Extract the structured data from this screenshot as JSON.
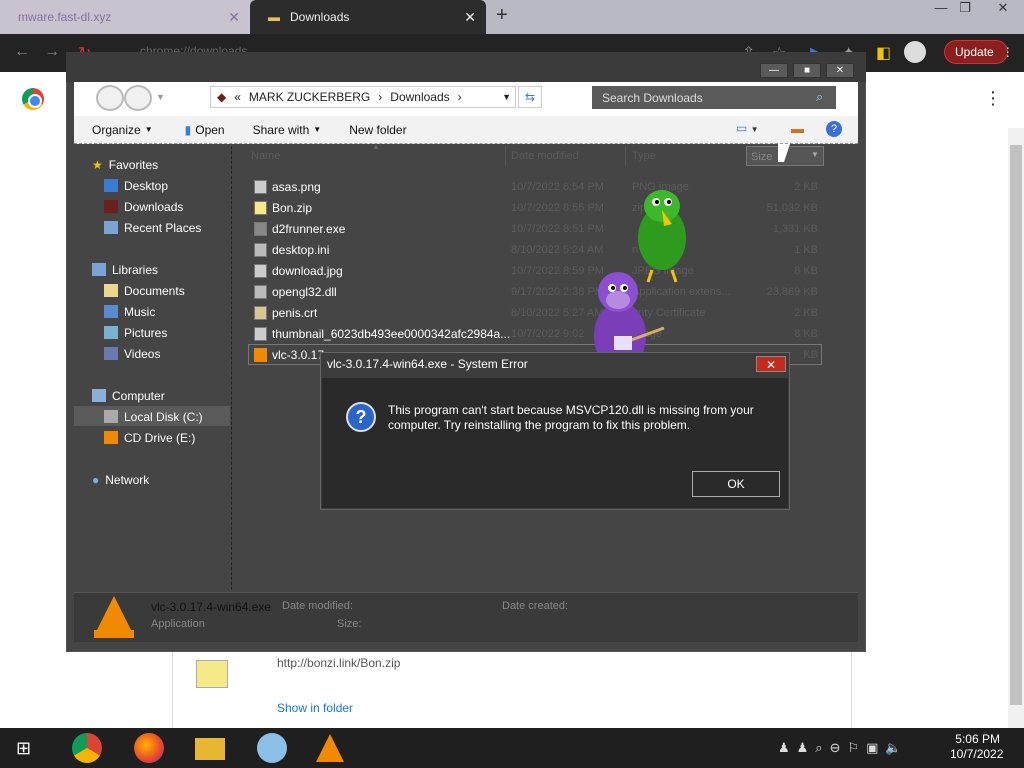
{
  "browser": {
    "tabs": [
      {
        "label": "mware.fast-dl.xyz"
      },
      {
        "label": "Downloads"
      }
    ],
    "address": "chrome://downloads",
    "update_label": "Update"
  },
  "explorer": {
    "breadcrumb": [
      "MARK ZUCKERBERG",
      "Downloads"
    ],
    "search_placeholder": "Search Downloads",
    "commands": [
      "Organize",
      "Open",
      "Share with",
      "New folder"
    ],
    "columns": [
      "Name",
      "Date modified",
      "Type",
      "Size"
    ],
    "nav": {
      "favorites": "Favorites",
      "favorites_items": [
        "Desktop",
        "Downloads",
        "Recent Places"
      ],
      "libraries": "Libraries",
      "libraries_items": [
        "Documents",
        "Music",
        "Pictures",
        "Videos"
      ],
      "computer": "Computer",
      "computer_items": [
        "Local Disk (C:)",
        "CD Drive (E:)"
      ],
      "network": "Network"
    },
    "files": [
      {
        "name": "asas.png",
        "date": "10/7/2022 8:54 PM",
        "type": "PNG image",
        "size": "2 KB"
      },
      {
        "name": "Bon.zip",
        "date": "10/7/2022 8:55 PM",
        "type": "zip",
        "size": "51,032 KB"
      },
      {
        "name": "d2frunner.exe",
        "date": "10/7/2022 8:51 PM",
        "type": "",
        "size": "1,331 KB"
      },
      {
        "name": "desktop.ini",
        "date": "8/10/2022 5:24 AM",
        "type": "n sett...",
        "size": "1 KB"
      },
      {
        "name": "download.jpg",
        "date": "10/7/2022 8:59 PM",
        "type": "JPEG image",
        "size": "8 KB"
      },
      {
        "name": "opengl32.dll",
        "date": "9/17/2020 2:38 PM",
        "type": "Application extens...",
        "size": "23,869 KB"
      },
      {
        "name": "penis.crt",
        "date": "8/10/2022 5:27 AM",
        "type": "urity Certificate",
        "size": "2 KB"
      },
      {
        "name": "thumbnail_6023db493ee0000342afc2984a...",
        "date": "10/7/2022 9:02",
        "type": "image",
        "size": "8 KB"
      },
      {
        "name": "vlc-3.0.17",
        "date": "",
        "type": "",
        "size": "KB"
      }
    ],
    "details": {
      "filename": "vlc-3.0.17.4-win64.exe",
      "filetype": "Application",
      "date_modified_label": "Date modified:",
      "date_created_label": "Date created:",
      "size_label": "Size:"
    }
  },
  "dialog": {
    "title": "vlc-3.0.17.4-win64.exe - System Error",
    "message": "This program can't start because MSVCP120.dll is missing from your computer. Try reinstalling the program to fix this problem.",
    "ok_label": "OK"
  },
  "downloads_page": {
    "url": "http://bonzi.link/Bon.zip",
    "show_in_folder": "Show in folder"
  },
  "taskbar": {
    "time": "5:06 PM",
    "date": "10/7/2022"
  }
}
